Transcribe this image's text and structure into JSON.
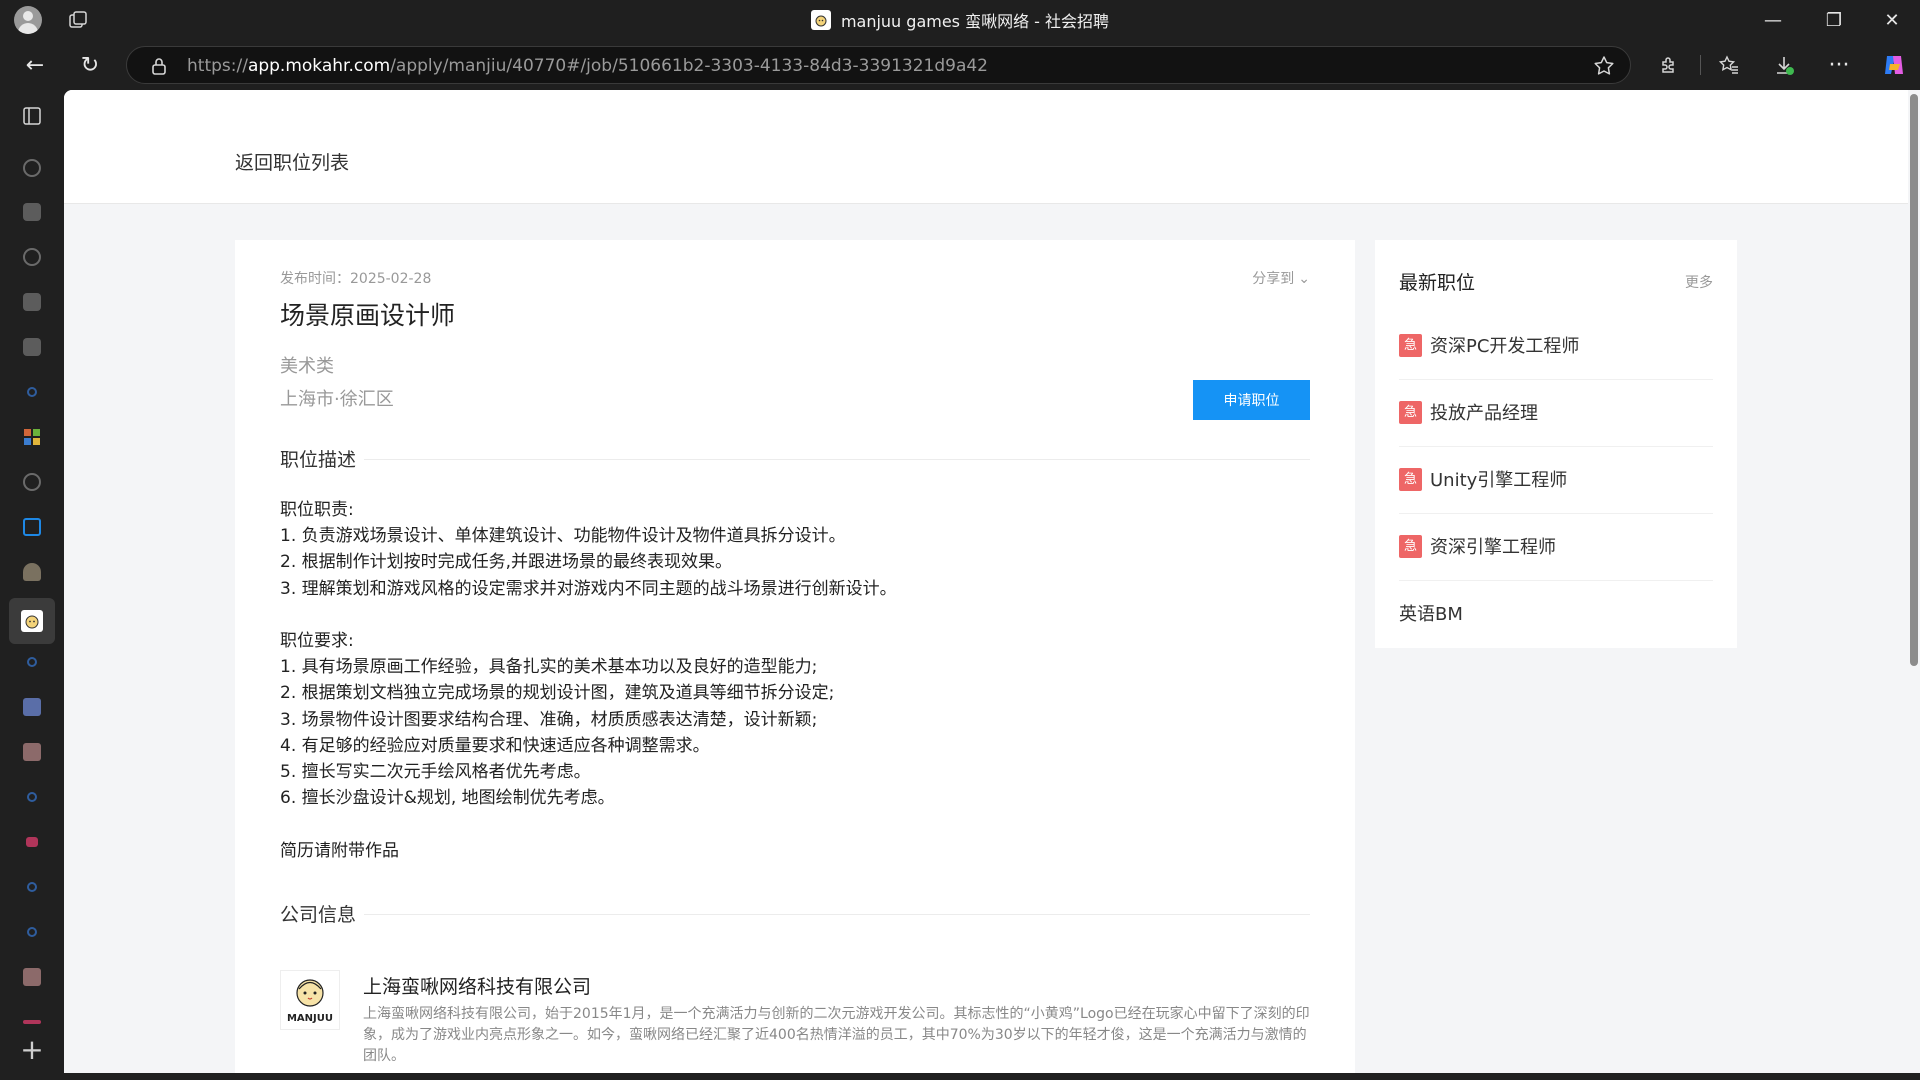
{
  "window": {
    "title": "manjuu games 蛮啾网络 - 社会招聘",
    "minimize": "—",
    "maximize": "❐",
    "close": "✕"
  },
  "nav": {
    "back": "←",
    "reload": "↻",
    "url_prefix": "https://",
    "url_host": "app.mokahr.com",
    "url_path": "/apply/manjiu/40770#/job/510661b2-3303-4133-84d3-3391321d9a42"
  },
  "toolbar": {
    "more": "···"
  },
  "sidebar_plus": "+",
  "page": {
    "back_to_list": "返回职位列表",
    "published_label": "发布时间：2025-02-28",
    "share_label": "分享到",
    "share_chevron": "⌄",
    "job_title": "场景原画设计师",
    "category": "美术类",
    "location": "上海市·徐汇区",
    "apply_button": "申请职位",
    "desc_heading": "职位描述",
    "description_lines": [
      "职位职责:",
      "1. 负责游戏场景设计、单体建筑设计、功能物件设计及物件道具拆分设计。",
      "2. 根据制作计划按时完成任务,并跟进场景的最终表现效果。",
      "3. 理解策划和游戏风格的设定需求并对游戏内不同主题的战斗场景进行创新设计。",
      "",
      "职位要求:",
      "1. 具有场景原画工作经验，具备扎实的美术基本功以及良好的造型能力;",
      "2. 根据策划文档独立完成场景的规划设计图，建筑及道具等细节拆分设定;",
      "3. 场景物件设计图要求结构合理、准确，材质质感表达清楚，设计新颖;",
      "4. 有足够的经验应对质量要求和快速适应各种调整需求。",
      "5. 擅长写实二次元手绘风格者优先考虑。",
      "6. 擅长沙盘设计&规划, 地图绘制优先考虑。",
      "",
      "简历请附带作品"
    ],
    "company_heading": "公司信息",
    "company_logo_text": "MANJUU",
    "company_name": "上海蛮啾网络科技有限公司",
    "company_desc": "上海蛮啾网络科技有限公司，始于2015年1月，是一个充满活力与创新的二次元游戏开发公司。其标志性的“小黄鸡”Logo已经在玩家心中留下了深刻的印象，成为了游戏业内亮点形象之一。如今，蛮啾网络已经汇聚了近400名热情洋溢的员工，其中70%为30岁以下的年轻才俊，这是一个充满活力与激情的团队。"
  },
  "side": {
    "title": "最新职位",
    "more": "更多",
    "urgent_label": "急",
    "jobs": [
      {
        "title": "资深PC开发工程师",
        "urgent": true
      },
      {
        "title": "投放产品经理",
        "urgent": true
      },
      {
        "title": "Unity引擎工程师",
        "urgent": true
      },
      {
        "title": "资深引擎工程师",
        "urgent": true
      },
      {
        "title": "英语BM",
        "urgent": false
      }
    ]
  },
  "colors": {
    "apply_button": "#1593f5",
    "urgent_badge": "#ee6666",
    "chrome_bg": "#1f1f1f",
    "page_bg": "#f4f5f7"
  }
}
